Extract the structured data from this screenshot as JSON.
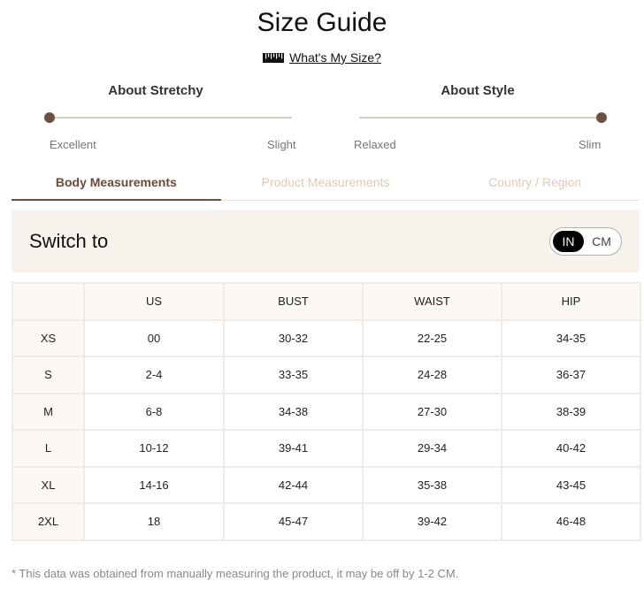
{
  "page": {
    "title": "Size Guide",
    "my_size_link": "What's My Size?",
    "ruler_icon": "ruler-icon"
  },
  "stretchy": {
    "title": "About Stretchy",
    "left_label": "Excellent",
    "right_label": "Slight",
    "level": 0
  },
  "style": {
    "title": "About Style",
    "left_label": "Relaxed",
    "right_label": "Slim",
    "level": 1
  },
  "tabs": [
    {
      "label": "Body Measurements",
      "active": true
    },
    {
      "label": "Product Measurements",
      "active": false
    },
    {
      "label": "Country / Region",
      "active": false
    }
  ],
  "switch": {
    "label": "Switch to",
    "options": [
      "IN",
      "CM"
    ],
    "selected": "IN"
  },
  "table": {
    "headers": [
      "",
      "US",
      "BUST",
      "WAIST",
      "HIP"
    ],
    "rows": [
      [
        "XS",
        "00",
        "30-32",
        "22-25",
        "34-35"
      ],
      [
        "S",
        "2-4",
        "33-35",
        "24-28",
        "36-37"
      ],
      [
        "M",
        "6-8",
        "34-38",
        "27-30",
        "38-39"
      ],
      [
        "L",
        "10-12",
        "39-41",
        "29-34",
        "40-42"
      ],
      [
        "XL",
        "14-16",
        "42-44",
        "35-38",
        "43-45"
      ],
      [
        "2XL",
        "18",
        "45-47",
        "39-42",
        "46-48"
      ]
    ]
  },
  "footnote": "* This data was obtained from manually measuring the product, it may be off by 1-2 CM.",
  "colors": {
    "accent": "#6e4e40",
    "panel_bg": "#f8f2ed",
    "inactive_tab": "#dccabd"
  }
}
